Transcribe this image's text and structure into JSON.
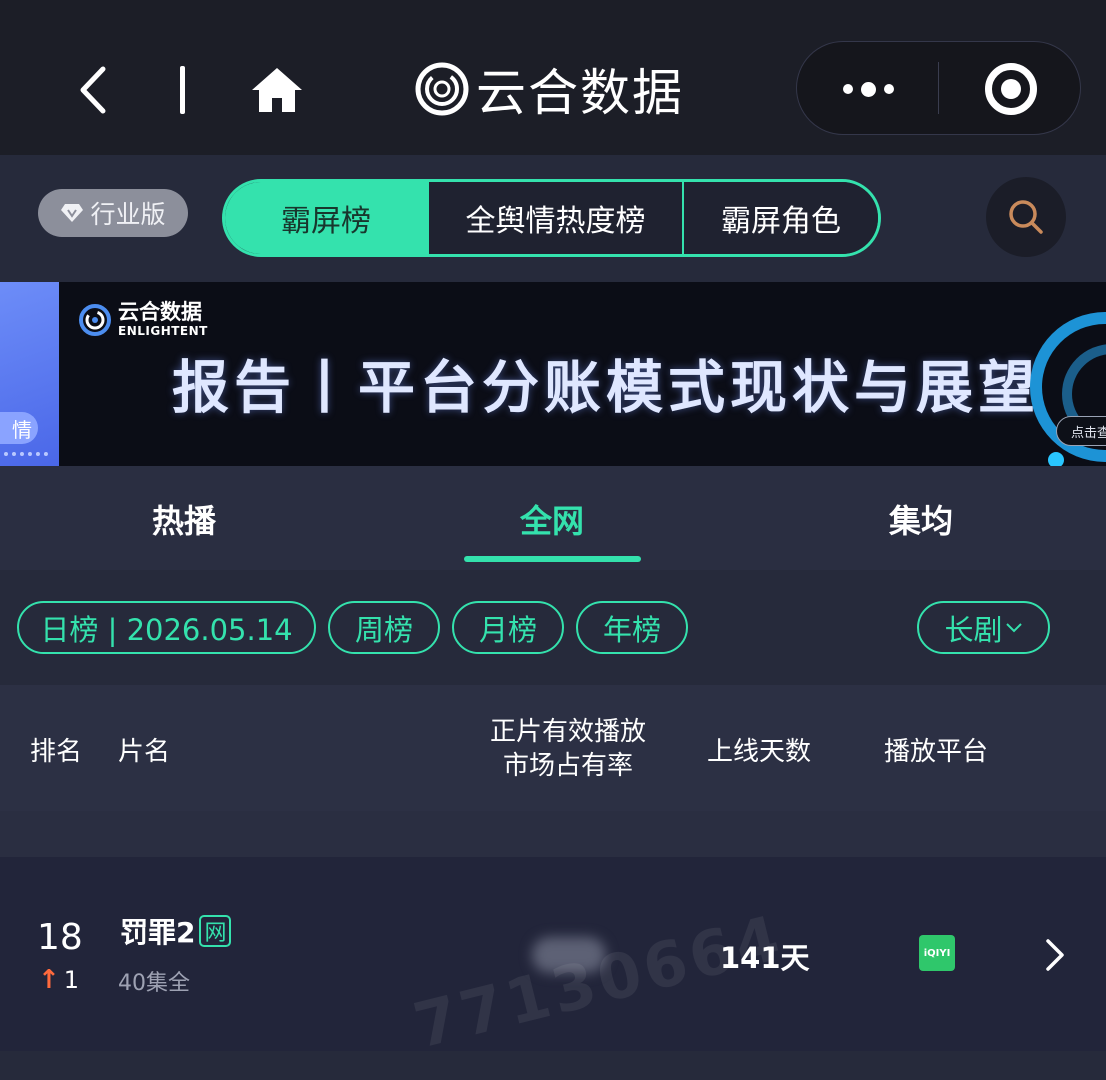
{
  "colors": {
    "accent": "#34e2ad",
    "background": "#262a3b",
    "topbar": "#1c1e27",
    "rank_up": "#ff6a3d",
    "iqiyi_green": "#2fc76b"
  },
  "topbar": {
    "brand_name": "云合数据",
    "icons": [
      "chevron-left-icon",
      "home-icon",
      "logo-icon",
      "more-dots-icon",
      "record-icon"
    ]
  },
  "tabbar": {
    "edition_label": "行业版",
    "segments": [
      "霸屏榜",
      "全舆情热度榜",
      "霸屏角色"
    ],
    "active_segment": "霸屏榜"
  },
  "banner": {
    "logo_cn": "云合数据",
    "logo_en": "ENLIGHTENT",
    "title": "报告丨平台分账模式现状与展望",
    "left_tag": "情",
    "cta": "点击查"
  },
  "subtabs": {
    "items": [
      "热播",
      "全网",
      "集均"
    ],
    "active": "全网"
  },
  "filters": {
    "daily": "日榜 | 2026.05.14",
    "weekly": "周榜",
    "monthly": "月榜",
    "yearly": "年榜",
    "type": "长剧"
  },
  "table": {
    "headers": {
      "rank": "排名",
      "title": "片名",
      "share": "正片有效播放\n市场占有率",
      "days": "上线天数",
      "platform": "播放平台"
    },
    "rows": [
      {
        "rank": "18",
        "rank_change": "1",
        "rank_direction": "up",
        "title": "罚罪2",
        "badge": "网",
        "episodes": "40集全",
        "days_online": "141天",
        "platform": "iQIYI"
      }
    ]
  },
  "watermark": "77130664"
}
